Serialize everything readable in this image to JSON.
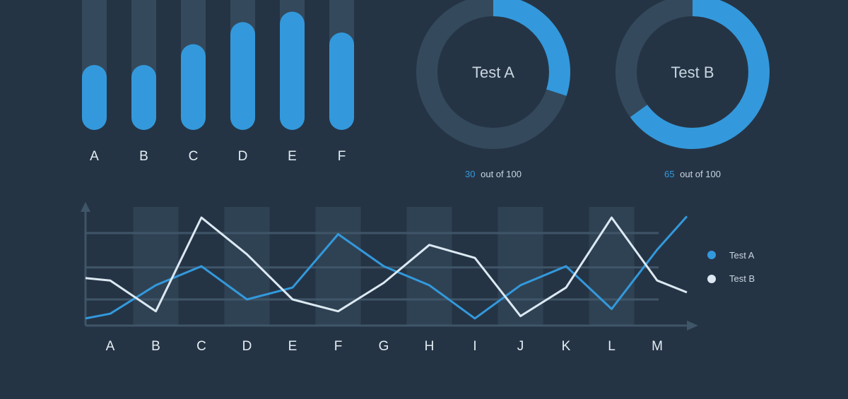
{
  "colors": {
    "background": "#253445",
    "track": "#34495c",
    "accent_blue": "#3399dc",
    "light_line": "#dce9f2",
    "axis": "#3f5568",
    "band": "#2f4254",
    "label": "#e4edf3",
    "muted_text": "#c9d6e0"
  },
  "chart_data": [
    {
      "type": "bar",
      "categories": [
        "A",
        "B",
        "C",
        "D",
        "E",
        "F"
      ],
      "values": [
        50,
        50,
        66,
        83,
        91,
        75
      ],
      "ylim": [
        0,
        100
      ],
      "title": "",
      "xlabel": "",
      "ylabel": ""
    },
    {
      "type": "pie",
      "title": "Test A",
      "value": 30,
      "total": 100,
      "caption_value": "30",
      "caption_rest": "out of 100"
    },
    {
      "type": "pie",
      "title": "Test B",
      "value": 65,
      "total": 100,
      "caption_value": "65",
      "caption_rest": "out of 100"
    },
    {
      "type": "line",
      "categories": [
        "A",
        "B",
        "C",
        "D",
        "E",
        "F",
        "G",
        "H",
        "I",
        "J",
        "K",
        "L",
        "M"
      ],
      "ylim": [
        0,
        100
      ],
      "grid": true,
      "legend_position": "right",
      "series": [
        {
          "name": "Test A",
          "values": [
            10,
            34,
            50,
            22,
            32,
            77,
            50,
            34,
            6,
            34,
            50,
            14,
            64
          ]
        },
        {
          "name": "Test B",
          "values": [
            38,
            12,
            91,
            60,
            22,
            12,
            36,
            68,
            57,
            8,
            32,
            91,
            38
          ]
        }
      ],
      "extra_points": {
        "A_end_value": 92,
        "B_start_value": 40,
        "B_end_value": 28
      }
    }
  ]
}
